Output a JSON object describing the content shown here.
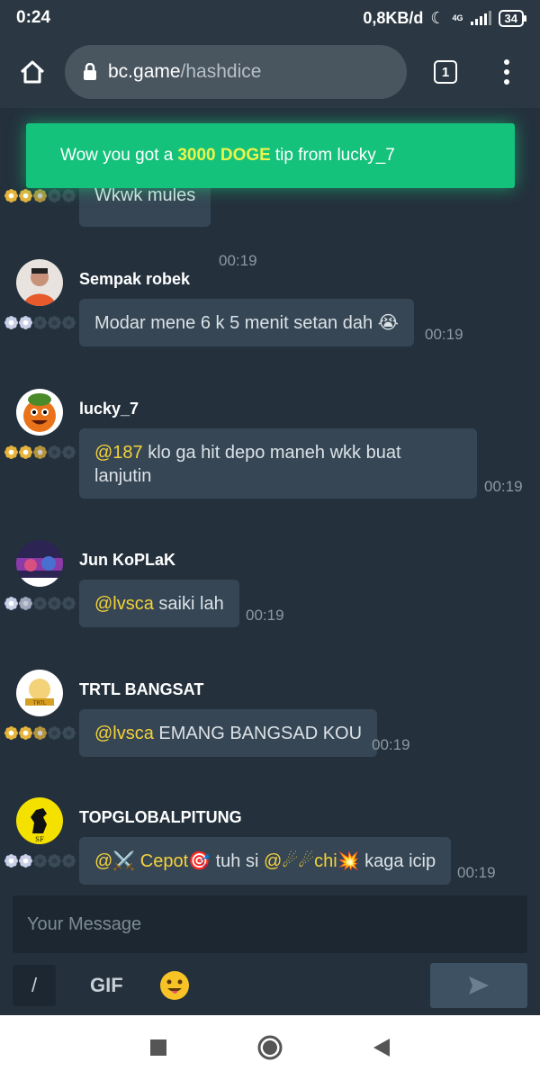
{
  "status_bar": {
    "time": "0:24",
    "net_speed": "0,8KB/d",
    "network_type": "4G",
    "battery": "34"
  },
  "browser": {
    "url_host": "bc.game",
    "url_path": "/hashdice",
    "tab_count": "1"
  },
  "toast": {
    "prefix": "Wow you got a",
    "amount": "3000 DOGE",
    "suffix": "tip from lucky_7"
  },
  "messages": [
    {
      "user": "",
      "text": "Wkwk mules",
      "time": "00:19",
      "mention": "",
      "stars_filled": 2.5
    },
    {
      "user": "Sempak robek",
      "text": "Modar mene 6 k 5 menit setan dah 😭",
      "time": "00:19",
      "mention": "",
      "stars_filled": 2
    },
    {
      "user": "lucky_7",
      "mention": "@187",
      "text_line1": " klo ga hit depo maneh wkk buat",
      "text_line2": "lanjutin",
      "time": "00:19",
      "stars_filled": 2.5
    },
    {
      "user": "Jun KoPLaK",
      "mention": "@lvsca",
      "text": " saiki lah",
      "time": "00:19",
      "stars_filled": 1.5
    },
    {
      "user": "TRTL BANGSAT",
      "mention": "@lvsca",
      "text": " EMANG BANGSAD KOU",
      "time": "00:19",
      "stars_filled": 2.5
    },
    {
      "user": "TOPGLOBALPITUNG",
      "mention1": "@⚔️ Cepot🎯",
      "text_mid": " tuh si ",
      "mention2": "@☄☄chi💥",
      "text_end": " kaga icip",
      "time": "00:19",
      "stars_filled": 2
    }
  ],
  "composer": {
    "placeholder": "Your Message",
    "slash_label": "/",
    "gif_label": "GIF",
    "emoji": "😛"
  },
  "colors": {
    "background": "#24313d",
    "bubble": "#364654",
    "toast": "#14c27c",
    "mention": "#f5d23a",
    "gold_star": "#e6b43c",
    "silver_star": "#c9cfe8"
  }
}
